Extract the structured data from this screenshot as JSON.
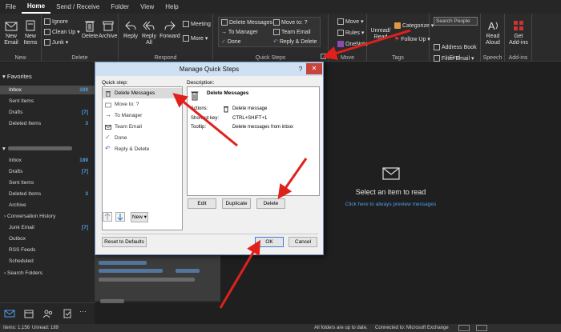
{
  "menu": {
    "tabs": [
      "File",
      "Home",
      "Send / Receive",
      "Folder",
      "View",
      "Help"
    ],
    "active_index": 1
  },
  "ribbon": {
    "new_group": {
      "label": "New",
      "new_email": "New Email",
      "new_items": "New Items"
    },
    "delete_group": {
      "label": "Delete",
      "ignore": "Ignore",
      "clean_up": "Clean Up",
      "junk": "Junk",
      "delete": "Delete",
      "archive": "Archive"
    },
    "respond_group": {
      "label": "Respond",
      "reply": "Reply",
      "reply_all": "Reply All",
      "forward": "Forward",
      "meeting": "Meeting",
      "more": "More"
    },
    "quick_steps_group": {
      "label": "Quick Steps",
      "items": [
        "Delete Messages",
        "Move to: ?",
        "To Manager",
        "Team Email",
        "Done",
        "Reply & Delete"
      ]
    },
    "move_group": {
      "label": "Move",
      "move": "Move",
      "rules": "Rules",
      "onenote": "OneNote"
    },
    "tags_group": {
      "label": "Tags",
      "unread_read": "Unread/ Read",
      "categorize": "Categorize",
      "follow_up": "Follow Up"
    },
    "find_group": {
      "label": "Find",
      "search_people": "Search People",
      "address_book": "Address Book",
      "filter_email": "Filter Email"
    },
    "speech_group": {
      "label": "Speech",
      "read_aloud": "Read Aloud"
    },
    "addins_group": {
      "label": "Add-ins",
      "get_addins": "Get Add-ins"
    }
  },
  "left_pane": {
    "favorites_label": "Favorites",
    "favorites": [
      {
        "label": "Inbox",
        "count": "189"
      },
      {
        "label": "Sent Items",
        "count": ""
      },
      {
        "label": "Drafts",
        "count": "[7]"
      },
      {
        "label": "Deleted Items",
        "count": "3"
      }
    ],
    "folders": [
      {
        "label": "Inbox",
        "count": "189"
      },
      {
        "label": "Drafts",
        "count": "[7]"
      },
      {
        "label": "Sent Items",
        "count": ""
      },
      {
        "label": "Deleted Items",
        "count": "3"
      },
      {
        "label": "Archive",
        "count": ""
      },
      {
        "label": "Conversation History",
        "count": ""
      },
      {
        "label": "Junk Email",
        "count": "[7]"
      },
      {
        "label": "Outbox",
        "count": ""
      },
      {
        "label": "RSS Feeds",
        "count": ""
      },
      {
        "label": "Scheduled",
        "count": ""
      },
      {
        "label": "Search Folders",
        "count": ""
      }
    ]
  },
  "reading_pane": {
    "title": "Select an item to read",
    "link": "Click here to always preview messages"
  },
  "status_bar": {
    "items": "Items: 1,156",
    "unread": "Unread: 189",
    "sync": "All folders are up to date.",
    "connection": "Connected to: Microsoft Exchange"
  },
  "dialog": {
    "title": "Manage Quick Steps",
    "help": "?",
    "close": "✕",
    "quick_step_label": "Quick step:",
    "description_label": "Description:",
    "quick_steps": [
      "Delete Messages",
      "Move to: ?",
      "To Manager",
      "Team Email",
      "Done",
      "Reply & Delete"
    ],
    "selected_index": 0,
    "description": {
      "name": "Delete Messages",
      "actions_label": "Actions:",
      "actions_value": "Delete message",
      "shortcut_label": "Shortcut key:",
      "shortcut_value": "CTRL+SHIFT+1",
      "tooltip_label": "Tooltip:",
      "tooltip_value": "Delete messages from inbox"
    },
    "buttons": {
      "edit": "Edit",
      "duplicate": "Duplicate",
      "delete": "Delete",
      "new": "New ▾",
      "reset": "Reset to Defaults",
      "ok": "OK",
      "cancel": "Cancel"
    }
  },
  "colors": {
    "accent_blue": "#4e9ee8",
    "dialog_title": "#cfe0f3",
    "close_red": "#c7453b",
    "pointer_red": "#e0201b"
  },
  "icons": [
    "new-email-icon",
    "trash-icon",
    "archive-icon",
    "reply-icon",
    "reply-all-icon",
    "forward-icon",
    "meeting-icon",
    "move-icon",
    "read-aloud-icon",
    "get-addins-icon",
    "envelope-icon",
    "mail-icon",
    "calendar-icon",
    "people-icon",
    "tasks-icon",
    "more-icon",
    "arrow-up-icon",
    "arrow-down-icon"
  ]
}
